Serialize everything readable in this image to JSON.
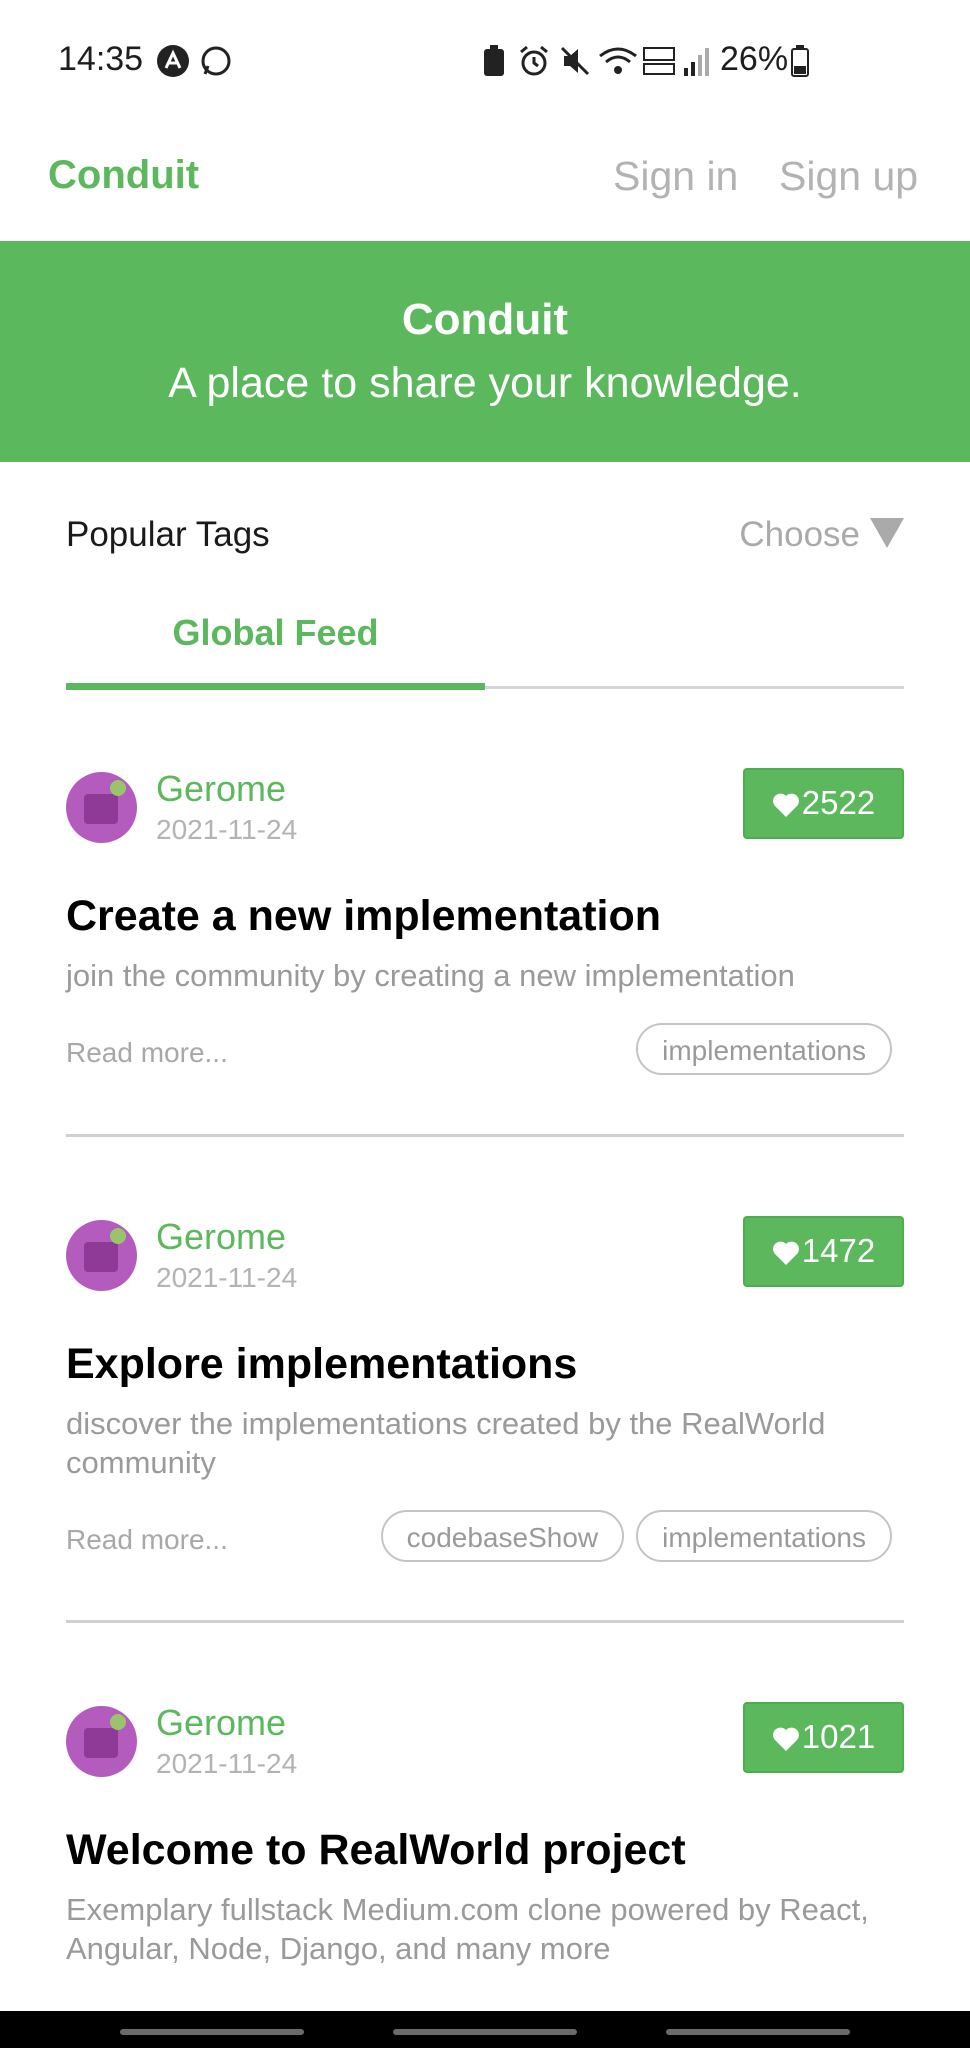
{
  "status_bar": {
    "time": "14:35",
    "battery_pct": "26%"
  },
  "navbar": {
    "brand": "Conduit",
    "sign_in": "Sign in",
    "sign_up": "Sign up"
  },
  "banner": {
    "title": "Conduit",
    "subtitle": "A place to share your knowledge."
  },
  "tags": {
    "label": "Popular Tags",
    "choose": "Choose"
  },
  "feed": {
    "active_tab": "Global Feed"
  },
  "articles": [
    {
      "author": "Gerome",
      "date": "2021-11-24",
      "likes": "2522",
      "title": "Create a new implementation",
      "description": "join the community by creating a new implementation",
      "read_more": "Read more...",
      "tags": [
        "implementations"
      ]
    },
    {
      "author": "Gerome",
      "date": "2021-11-24",
      "likes": "1472",
      "title": "Explore implementations",
      "description": "discover the implementations created by the RealWorld community",
      "read_more": "Read more...",
      "tags": [
        "codebaseShow",
        "implementations"
      ]
    },
    {
      "author": "Gerome",
      "date": "2021-11-24",
      "likes": "1021",
      "title": "Welcome to RealWorld project",
      "description": "Exemplary fullstack Medium.com clone powered by React, Angular, Node, Django, and many more",
      "read_more": "",
      "tags": []
    }
  ],
  "colors": {
    "accent": "#5cb85c",
    "muted": "#b3b3b3"
  },
  "icons": [
    "heart-icon",
    "chevron-down-icon"
  ]
}
